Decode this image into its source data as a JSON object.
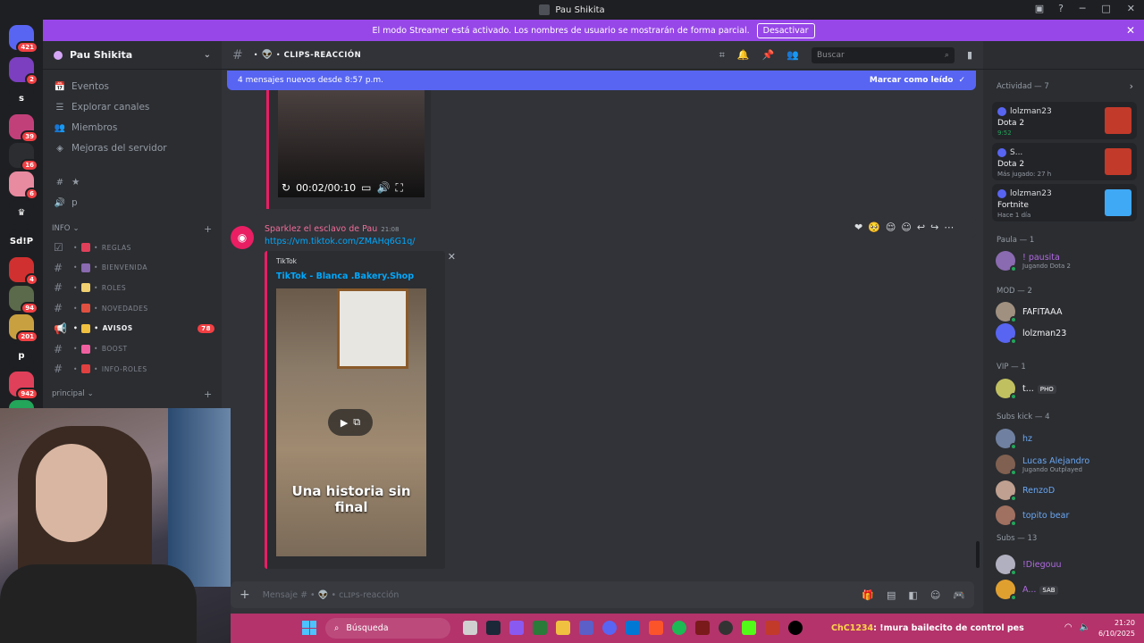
{
  "window": {
    "title": "Pau Shikita"
  },
  "banner": {
    "text": "El modo Streamer está activado. Los nombres de usuario se mostrarán de forma parcial.",
    "button": "Desactivar"
  },
  "guilds": [
    {
      "label": "",
      "badge": "421",
      "color": "#5865f2"
    },
    {
      "label": "",
      "badge": "2",
      "color": "#7b3fbf"
    },
    {
      "label": "s",
      "badge": "",
      "color": "#1e1f22"
    },
    {
      "label": "",
      "badge": "39",
      "color": "#c2407a"
    },
    {
      "label": "",
      "badge": "16",
      "color": "#2b2d31"
    },
    {
      "label": "",
      "badge": "6",
      "color": "#e88aa0"
    },
    {
      "label": "♛",
      "badge": "",
      "color": "#1e1f22"
    },
    {
      "label": "Sd!P",
      "badge": "",
      "color": "#1e1f22"
    },
    {
      "label": "",
      "badge": "4",
      "color": "#d13030"
    },
    {
      "label": "",
      "badge": "94",
      "color": "#5a6a4a"
    },
    {
      "label": "",
      "badge": "201",
      "color": "#c9a040"
    },
    {
      "label": "p",
      "badge": "",
      "color": "#1e1f22"
    },
    {
      "label": "",
      "badge": "942",
      "color": "#e0405a"
    },
    {
      "label": "",
      "badge": "",
      "color": "#23a55a"
    }
  ],
  "server": {
    "name": "Pau Shikita"
  },
  "sidebar_nav": [
    {
      "label": "Eventos",
      "icon": "📅"
    },
    {
      "label": "Explorar canales",
      "icon": "☰"
    },
    {
      "label": "Miembros",
      "icon": "👥"
    },
    {
      "label": "Mejoras del servidor",
      "icon": "◈"
    }
  ],
  "extra_channels": [
    {
      "label": "★",
      "icon": "#"
    },
    {
      "label": "p",
      "icon": "🔊"
    }
  ],
  "categories": {
    "info": "INFO",
    "principal": "principal"
  },
  "channels": [
    {
      "name": "REGLAS",
      "icon": "☑",
      "emoji_color": "#e0405a",
      "bold": false,
      "badge": ""
    },
    {
      "name": "BIENVENIDA",
      "icon": "#",
      "emoji_color": "#8a6ab0",
      "bold": false,
      "badge": ""
    },
    {
      "name": "ROLES",
      "icon": "#",
      "emoji_color": "#f0d070",
      "bold": false,
      "badge": ""
    },
    {
      "name": "NOVEDADES",
      "icon": "#",
      "emoji_color": "#e05040",
      "bold": false,
      "badge": ""
    },
    {
      "name": "AVISOS",
      "icon": "📢",
      "emoji_color": "#f0c040",
      "bold": true,
      "badge": "78"
    },
    {
      "name": "BOOST",
      "icon": "#",
      "emoji_color": "#f060a0",
      "bold": false,
      "badge": ""
    },
    {
      "name": "INFO-ROLES",
      "icon": "#",
      "emoji_color": "#e04040",
      "bold": false,
      "badge": ""
    }
  ],
  "chat": {
    "channel_name": "CLIPS-REACCIÓN",
    "search_placeholder": "Buscar",
    "new_messages": "4 mensajes nuevos desde 8:57 p.m.",
    "mark_read": "Marcar como leído",
    "video_time": "00:02/00:10",
    "message": {
      "author": "Sparklez el esclavo de Pau",
      "timestamp": "21:08",
      "link": "https://vm.tiktok.com/ZMAHq6G1q/",
      "embed_provider": "TikTok",
      "embed_title": "TikTok - Blanca .Bakery.Shop",
      "caption": "Una historia sin final"
    },
    "composer_placeholder": "Mensaje # • 👽 • ᴄʟɪᴘs-reacción"
  },
  "members": {
    "activity_title": "Actividad — 7",
    "activities": [
      {
        "user": "lolzman23",
        "game": "Dota 2",
        "sub": "9:52",
        "green": true,
        "color": "#c23a2a"
      },
      {
        "user": "S...",
        "game": "Dota 2",
        "sub": "Más jugado: 27 h",
        "green": false,
        "color": "#c23a2a"
      },
      {
        "user": "lolzman23",
        "game": "Fortnite",
        "sub": "Hace 1 día",
        "green": false,
        "color": "#3fa9f5"
      }
    ],
    "groups": [
      {
        "title": "Paula — 1",
        "members": [
          {
            "name": "! pausita",
            "status": "Jugando Dota 2",
            "color": "#b06ae0",
            "av": "#8a6ab0"
          }
        ]
      },
      {
        "title": "MOD — 2",
        "members": [
          {
            "name": "FAFITAAA",
            "status": "",
            "color": "#f2f3f5",
            "av": "#a09080"
          },
          {
            "name": "lolzman23",
            "status": "",
            "color": "#f2f3f5",
            "av": "#5865f2"
          }
        ]
      },
      {
        "title": "VIP — 1",
        "members": [
          {
            "name": "t...",
            "status": "",
            "color": "#f2f3f5",
            "av": "#c0c060",
            "tag": "PHO"
          }
        ]
      },
      {
        "title": "Subs kick — 4",
        "members": [
          {
            "name": "hz",
            "status": "",
            "color": "#6aa8f5",
            "av": "#7080a0"
          },
          {
            "name": "Lucas Alejandro",
            "status": "Jugando Outplayed",
            "color": "#6aa8f5",
            "av": "#806050"
          },
          {
            "name": "RenzoD",
            "status": "",
            "color": "#6aa8f5",
            "av": "#c0a090"
          },
          {
            "name": "topito bear",
            "status": "",
            "color": "#6aa8f5",
            "av": "#a07060"
          }
        ]
      },
      {
        "title": "Subs — 13",
        "members": [
          {
            "name": "!Diegouu",
            "status": "",
            "color": "#b06ae0",
            "av": "#b0b0c0"
          },
          {
            "name": "A...",
            "status": "",
            "color": "#b06ae0",
            "av": "#e0a030",
            "tag": "SAB"
          }
        ]
      }
    ]
  },
  "taskbar": {
    "search": "Búsqueda",
    "ticker_user": "ChC1234",
    "ticker_msg": ": !mura bailecito de control pes",
    "time": "21:20",
    "date": "6/10/2025"
  }
}
